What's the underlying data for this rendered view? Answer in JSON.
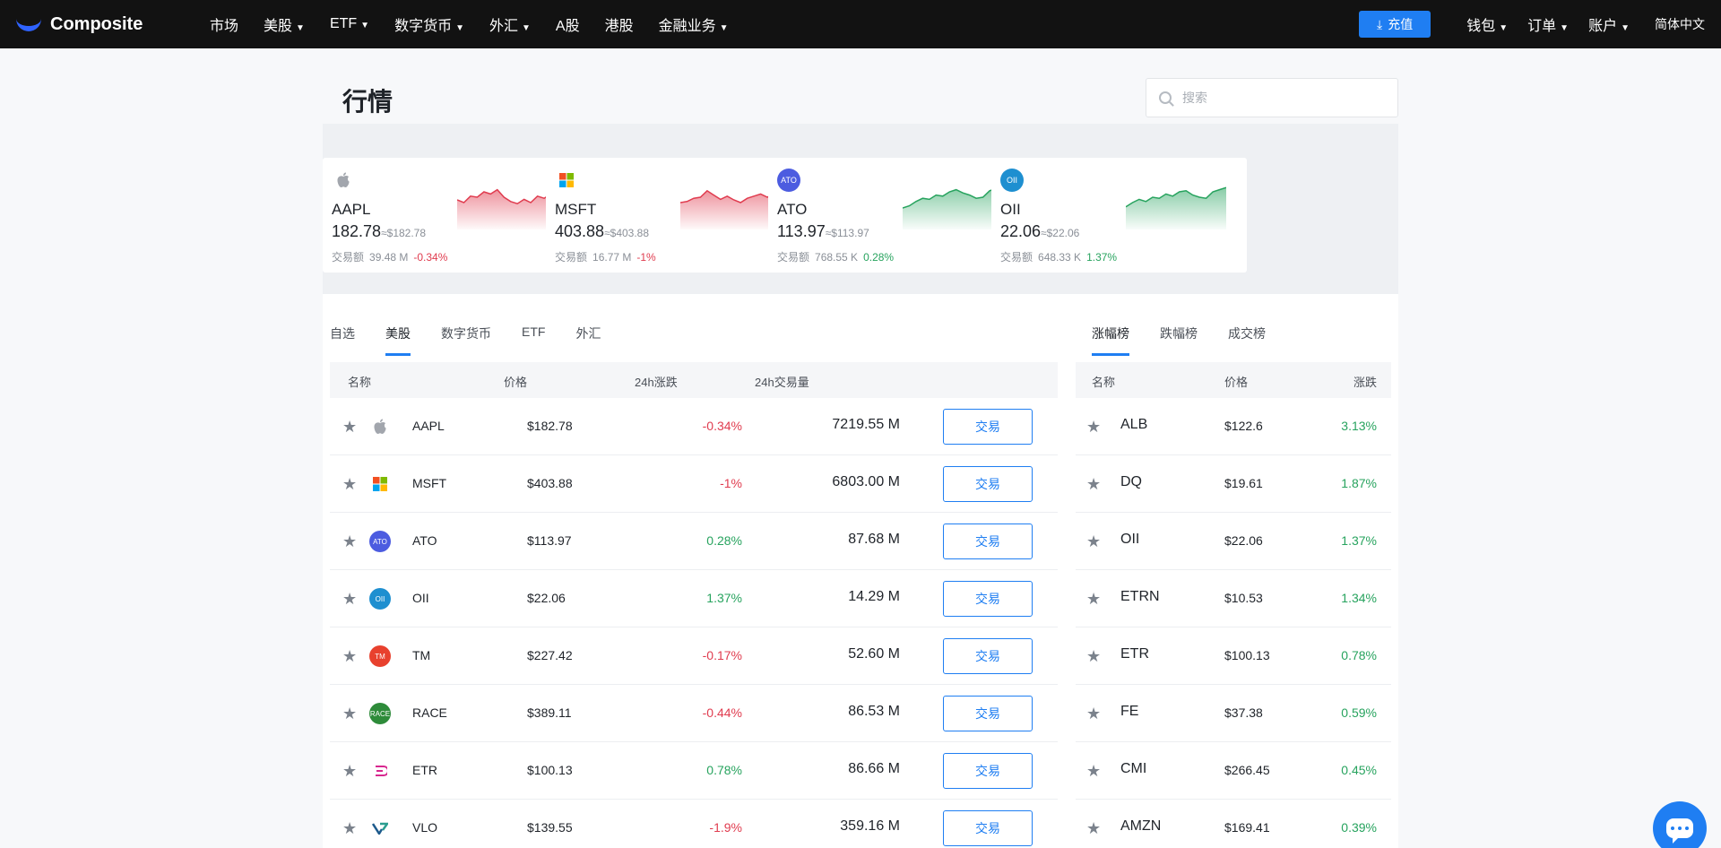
{
  "nav": {
    "brand": "Composite",
    "items": [
      {
        "label": "市场",
        "caret": false
      },
      {
        "label": "美股",
        "caret": true
      },
      {
        "label": "ETF",
        "caret": true
      },
      {
        "label": "数字货币",
        "caret": true
      },
      {
        "label": "外汇",
        "caret": true
      },
      {
        "label": "A股",
        "caret": false
      },
      {
        "label": "港股",
        "caret": false
      },
      {
        "label": "金融业务",
        "caret": true
      }
    ],
    "deposit": "充值",
    "wallet": "钱包",
    "orders": "订单",
    "account": "账户",
    "lang": "简体中文"
  },
  "page": {
    "title": "行情"
  },
  "search": {
    "placeholder": "搜索"
  },
  "tickers": [
    {
      "symbol": "AAPL",
      "price": "182.78",
      "approx": "≈$182.78",
      "volume_label": "交易额",
      "volume": "39.48 M",
      "change": "-0.34%",
      "dir": "down",
      "icon": "apple-icon",
      "icon_color": "#a2a6ad",
      "icon_text": "",
      "spark": [
        0.55,
        0.5,
        0.62,
        0.6,
        0.7,
        0.66,
        0.74,
        0.6,
        0.52,
        0.48,
        0.56,
        0.5,
        0.62,
        0.58,
        0.66,
        0.6
      ]
    },
    {
      "symbol": "MSFT",
      "price": "403.88",
      "approx": "≈$403.88",
      "volume_label": "交易额",
      "volume": "16.77 M",
      "change": "-1%",
      "dir": "down",
      "icon": "microsoft-icon",
      "icon_color": "#ffffff",
      "icon_text": "",
      "spark": [
        0.5,
        0.52,
        0.58,
        0.6,
        0.72,
        0.64,
        0.56,
        0.62,
        0.55,
        0.5,
        0.58,
        0.62,
        0.66,
        0.6,
        0.68,
        0.62
      ]
    },
    {
      "symbol": "ATO",
      "price": "113.97",
      "approx": "≈$113.97",
      "volume_label": "交易额",
      "volume": "768.55 K",
      "change": "0.28%",
      "dir": "up",
      "icon": "ato-icon",
      "icon_color": "#4c5ce0",
      "icon_text": "ATO",
      "spark": [
        0.4,
        0.44,
        0.52,
        0.58,
        0.56,
        0.64,
        0.62,
        0.7,
        0.74,
        0.68,
        0.64,
        0.58,
        0.6,
        0.72,
        0.76,
        0.8
      ]
    },
    {
      "symbol": "OII",
      "price": "22.06",
      "approx": "≈$22.06",
      "volume_label": "交易额",
      "volume": "648.33 K",
      "change": "1.37%",
      "dir": "up",
      "icon": "oii-icon",
      "icon_color": "#1e8fd0",
      "icon_text": "OII",
      "spark": [
        0.42,
        0.5,
        0.56,
        0.52,
        0.6,
        0.58,
        0.66,
        0.62,
        0.7,
        0.72,
        0.64,
        0.6,
        0.58,
        0.7,
        0.74,
        0.78
      ]
    }
  ],
  "market_tabs": [
    "自选",
    "美股",
    "数字货币",
    "ETF",
    "外汇"
  ],
  "market_active_tab": 1,
  "market_headers": {
    "name": "名称",
    "price": "价格",
    "change": "24h涨跌",
    "volume": "24h交易量"
  },
  "market_rows": [
    {
      "symbol": "AAPL",
      "price": "$182.78",
      "change": "-0.34%",
      "dir": "down",
      "volume": "7219.55 M",
      "icon": "apple-icon",
      "icon_color": "#a2a6ad",
      "icon_text": ""
    },
    {
      "symbol": "MSFT",
      "price": "$403.88",
      "change": "-1%",
      "dir": "down",
      "volume": "6803.00 M",
      "icon": "microsoft-icon",
      "icon_color": "#ffffff",
      "icon_text": ""
    },
    {
      "symbol": "ATO",
      "price": "$113.97",
      "change": "0.28%",
      "dir": "up",
      "volume": "87.68 M",
      "icon": "ato-icon",
      "icon_color": "#4c5ce0",
      "icon_text": "ATO"
    },
    {
      "symbol": "OII",
      "price": "$22.06",
      "change": "1.37%",
      "dir": "up",
      "volume": "14.29 M",
      "icon": "oii-icon",
      "icon_color": "#1e8fd0",
      "icon_text": "OII"
    },
    {
      "symbol": "TM",
      "price": "$227.42",
      "change": "-0.17%",
      "dir": "down",
      "volume": "52.60 M",
      "icon": "tm-icon",
      "icon_color": "#e8412e",
      "icon_text": "TM"
    },
    {
      "symbol": "RACE",
      "price": "$389.11",
      "change": "-0.44%",
      "dir": "down",
      "volume": "86.53 M",
      "icon": "race-icon",
      "icon_color": "#2e8b3a",
      "icon_text": "RACE"
    },
    {
      "symbol": "ETR",
      "price": "$100.13",
      "change": "0.78%",
      "dir": "up",
      "volume": "86.66 M",
      "icon": "etr-icon",
      "icon_color": "#ffffff",
      "icon_text": ""
    },
    {
      "symbol": "VLO",
      "price": "$139.55",
      "change": "-1.9%",
      "dir": "down",
      "volume": "359.16 M",
      "icon": "vlo-icon",
      "icon_color": "#ffffff",
      "icon_text": ""
    }
  ],
  "trade_label": "交易",
  "rank_tabs": [
    "涨幅榜",
    "跌幅榜",
    "成交榜"
  ],
  "rank_active_tab": 0,
  "rank_headers": {
    "name": "名称",
    "price": "价格",
    "change": "涨跌"
  },
  "rank_rows": [
    {
      "symbol": "ALB",
      "price": "$122.6",
      "change": "3.13%"
    },
    {
      "symbol": "DQ",
      "price": "$19.61",
      "change": "1.87%"
    },
    {
      "symbol": "OII",
      "price": "$22.06",
      "change": "1.37%"
    },
    {
      "symbol": "ETRN",
      "price": "$10.53",
      "change": "1.34%"
    },
    {
      "symbol": "ETR",
      "price": "$100.13",
      "change": "0.78%"
    },
    {
      "symbol": "FE",
      "price": "$37.38",
      "change": "0.59%"
    },
    {
      "symbol": "CMI",
      "price": "$266.45",
      "change": "0.45%"
    },
    {
      "symbol": "AMZN",
      "price": "$169.41",
      "change": "0.39%"
    }
  ],
  "colors": {
    "up": "#27a35e",
    "down": "#e03c4f",
    "accent": "#1f7ef2"
  }
}
